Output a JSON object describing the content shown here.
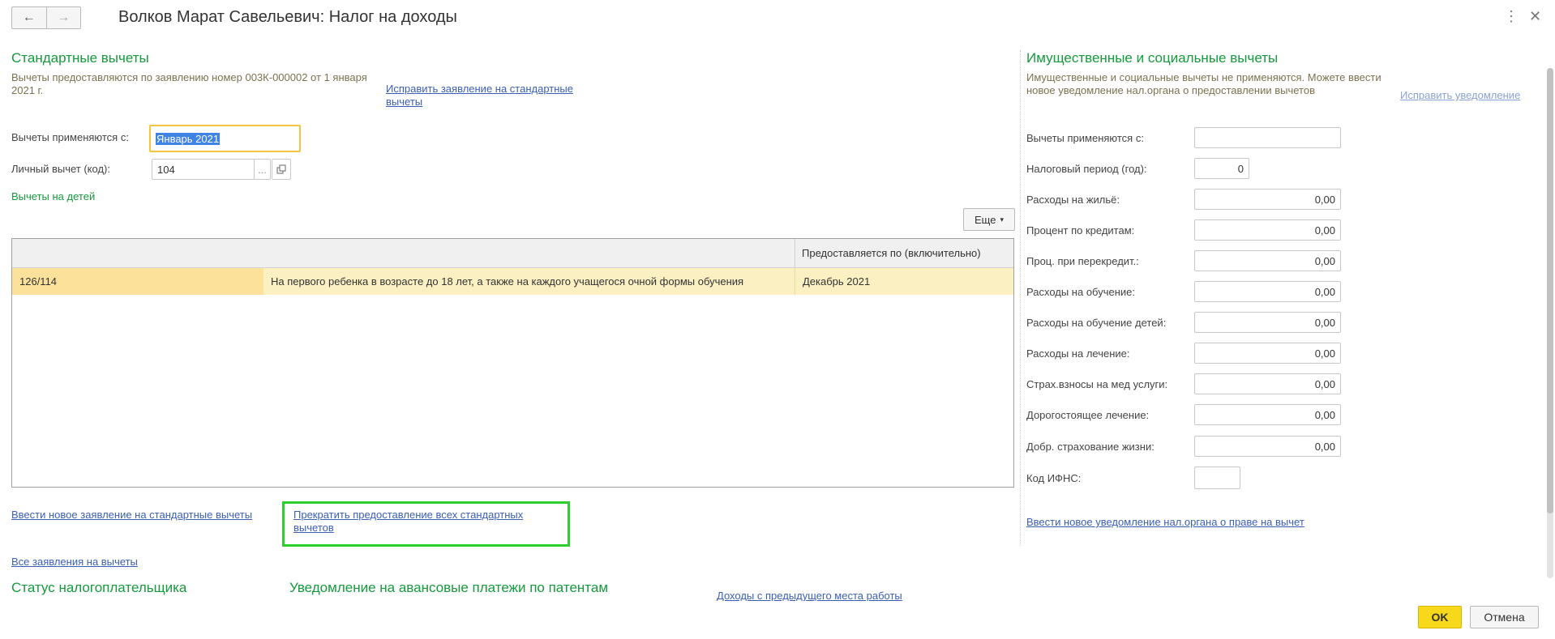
{
  "window": {
    "title": "Волков Марат Савельевич: Налог на доходы",
    "back_icon": "←",
    "forward_icon": "→",
    "more_icon": "⋮",
    "close_icon": "✕"
  },
  "standard": {
    "title": "Стандартные вычеты",
    "note": "Вычеты предоставляются по заявлению номер 003К-000002 от 1 января 2021 г.",
    "fix_link": "Исправить заявление на стандартные вычеты",
    "apply_from_label": "Вычеты применяются с:",
    "apply_from_value": "Январь 2021",
    "personal_label": "Личный вычет (код):",
    "personal_value": "104",
    "ellipsis": "...",
    "children_link": "Вычеты на детей",
    "more_button": "Еще",
    "table": {
      "col_end_header": "Предоставляется по (включительно)",
      "rows": [
        {
          "code": "126/114",
          "description": "На первого ребенка в возрасте до 18 лет, а также на каждого учащегося очной формы обучения",
          "end": "Декабрь 2021"
        }
      ]
    },
    "new_application_link": "Ввести новое заявление на стандартные вычеты",
    "stop_link": "Прекратить предоставление всех стандартных вычетов",
    "all_applications_link": "Все заявления на вычеты"
  },
  "bottom": {
    "status_title": "Статус налогоплательщика",
    "patent_title": "Уведомление на авансовые платежи по патентам",
    "prev_income_link": "Доходы с предыдущего места работы"
  },
  "property": {
    "title": "Имущественные и социальные вычеты",
    "note": "Имущественные и социальные вычеты не применяются. Можете ввести новое уведомление нал.органа о предоставлении вычетов",
    "fix_link": "Исправить уведомление",
    "apply_from_label": "Вычеты применяются с:",
    "apply_from_value": "",
    "period_label": "Налоговый период (год):",
    "period_value": "0",
    "fields": [
      {
        "label": "Расходы на жильё:",
        "value": "0,00"
      },
      {
        "label": "Процент по кредитам:",
        "value": "0,00"
      },
      {
        "label": "Проц. при перекредит.:",
        "value": "0,00"
      },
      {
        "label": "Расходы на обучение:",
        "value": "0,00"
      },
      {
        "label": "Расходы на обучение детей:",
        "value": "0,00"
      },
      {
        "label": "Расходы на лечение:",
        "value": "0,00"
      },
      {
        "label": "Страх.взносы на мед услуги:",
        "value": "0,00"
      },
      {
        "label": "Дорогостоящее лечение:",
        "value": "0,00"
      },
      {
        "label": "Добр. страхование жизни:",
        "value": "0,00"
      }
    ],
    "ifns_label": "Код ИФНС:",
    "ifns_value": "",
    "new_notice_link": "Ввести новое уведомление нал.органа о праве на вычет"
  },
  "footer": {
    "ok": "OK",
    "cancel": "Отмена"
  }
}
